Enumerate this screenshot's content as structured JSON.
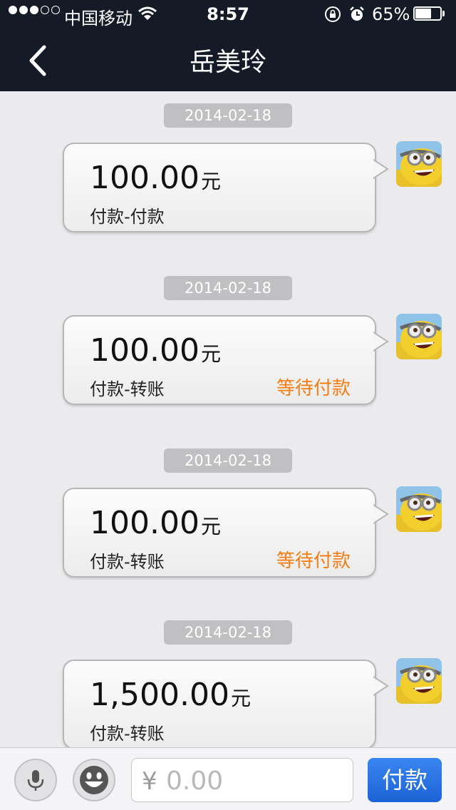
{
  "status_bar": {
    "carrier": "中国移动",
    "time": "8:57",
    "battery_percent": "65%",
    "battery_level": 0.65
  },
  "nav": {
    "title": "岳美玲"
  },
  "messages": [
    {
      "date": "2014-02-18",
      "amount": "100.00",
      "unit": "元",
      "description": "付款-付款",
      "status": ""
    },
    {
      "date": "2014-02-18",
      "amount": "100.00",
      "unit": "元",
      "description": "付款-转账",
      "status": "等待付款"
    },
    {
      "date": "2014-02-18",
      "amount": "100.00",
      "unit": "元",
      "description": "付款-转账",
      "status": "等待付款"
    },
    {
      "date": "2014-02-18",
      "amount": "1,500.00",
      "unit": "元",
      "description": "付款-转账",
      "status": ""
    }
  ],
  "input_bar": {
    "currency_symbol": "¥",
    "amount_placeholder": "0.00",
    "pay_label": "付款"
  },
  "colors": {
    "nav_background": "#151b26",
    "pending_status": "#f57c12",
    "pay_button": "#2a74e6"
  },
  "icons": {
    "back": "chevron-left",
    "wifi": "wifi",
    "lock": "rotation-lock",
    "alarm": "alarm-clock",
    "mic": "microphone",
    "emoji": "smiley-face"
  }
}
